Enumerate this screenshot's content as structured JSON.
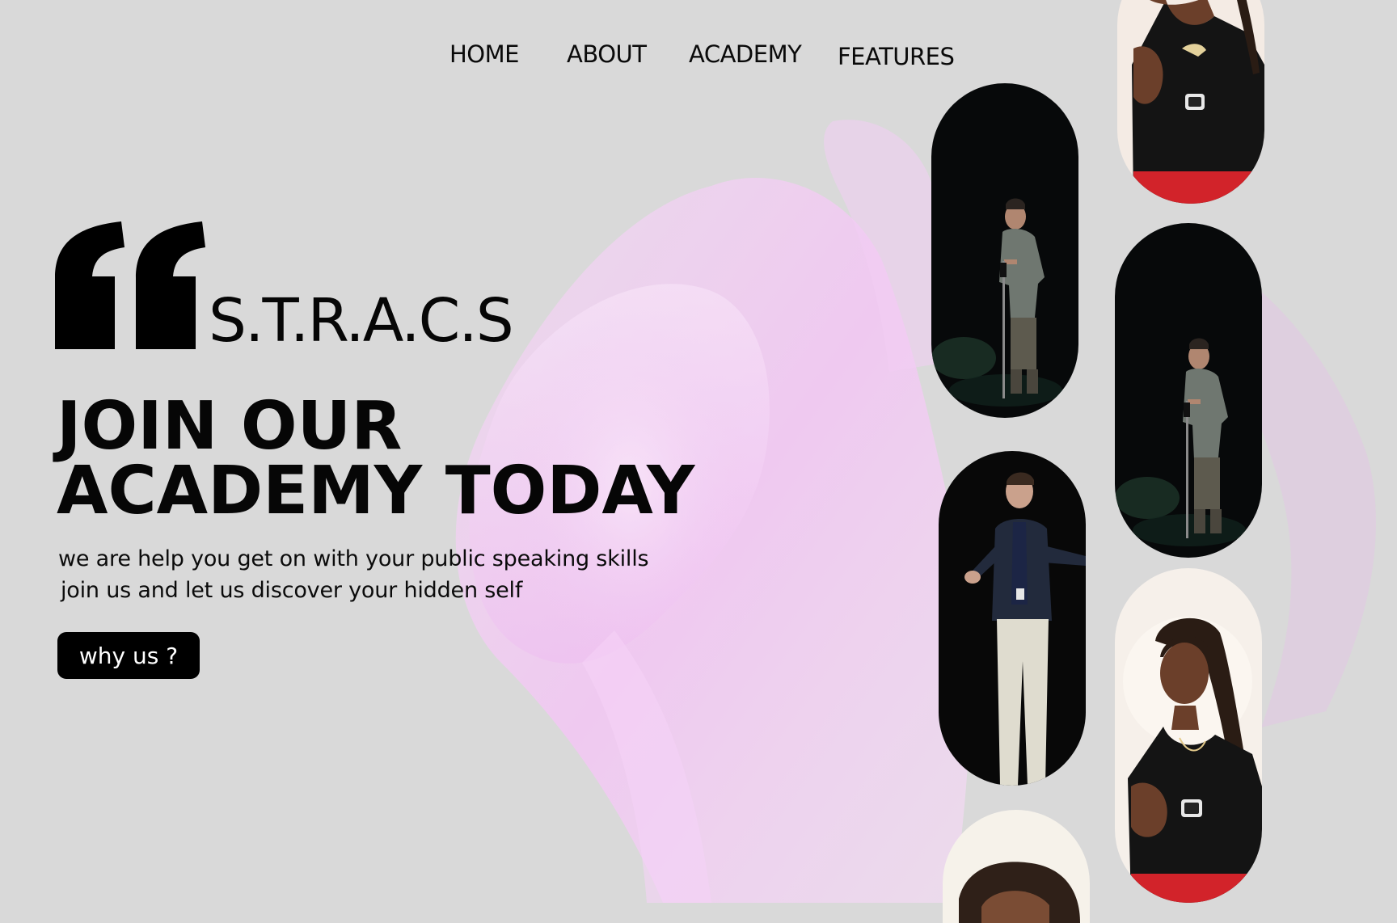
{
  "nav": {
    "items": [
      {
        "label": "HOME"
      },
      {
        "label": "ABOUT"
      },
      {
        "label": "ACADEMY"
      },
      {
        "label": "FEATURES"
      }
    ]
  },
  "brand": {
    "name": "S.T.R.A.C.S",
    "mark_icon": "quote-mark-icon"
  },
  "hero": {
    "title_line1": "JOIN OUR",
    "title_line2": "ACADEMY TODAY",
    "subtitle_line1": "we are help you get on with your public speaking skills",
    "subtitle_line2": "join us and let us discover your hidden self",
    "cta_label": "why us ?"
  },
  "colors": {
    "background": "#d9d9d9",
    "accent_silk": "#f0c9f2",
    "text": "#060606",
    "button_bg": "#000000",
    "button_text": "#ffffff"
  }
}
